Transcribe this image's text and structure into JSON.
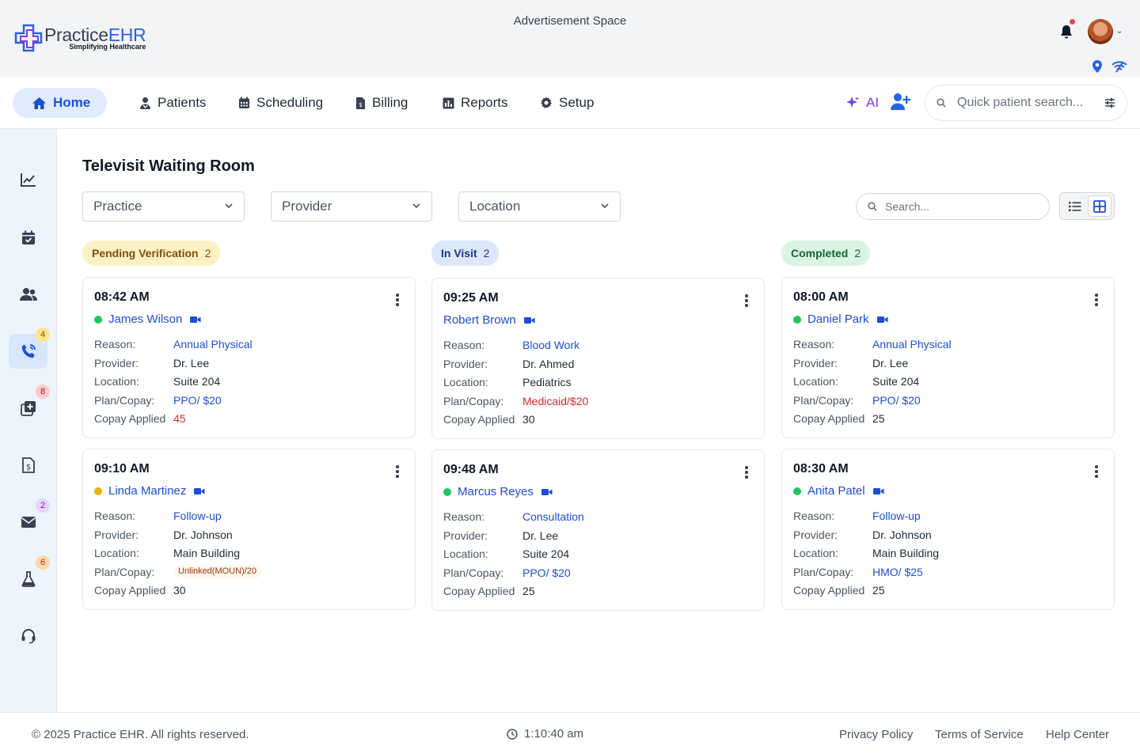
{
  "header": {
    "logo_practice": "Practice",
    "logo_ehr": "EHR",
    "logo_tagline": "Simplifying Healthcare",
    "ad_space": "Advertisement Space"
  },
  "nav": {
    "items": [
      {
        "label": "Home",
        "icon": "home-icon"
      },
      {
        "label": "Patients",
        "icon": "patient-icon"
      },
      {
        "label": "Scheduling",
        "icon": "calendar-icon"
      },
      {
        "label": "Billing",
        "icon": "invoice-icon"
      },
      {
        "label": "Reports",
        "icon": "chart-icon"
      },
      {
        "label": "Setup",
        "icon": "gear-icon"
      }
    ],
    "ai_label": "AI",
    "quick_search_placeholder": "Quick patient search..."
  },
  "sidebar": {
    "items": [
      {
        "icon": "analytics-icon",
        "badge": ""
      },
      {
        "icon": "calendar-check-icon",
        "badge": ""
      },
      {
        "icon": "users-icon",
        "badge": ""
      },
      {
        "icon": "phone-icon",
        "badge": "4"
      },
      {
        "icon": "medical-plus-icon",
        "badge": "8"
      },
      {
        "icon": "billing-doc-icon",
        "badge": ""
      },
      {
        "icon": "mail-icon",
        "badge": "2"
      },
      {
        "icon": "flask-icon",
        "badge": "6"
      },
      {
        "icon": "headset-icon",
        "badge": ""
      }
    ]
  },
  "main": {
    "title": "Televisit Waiting Room",
    "filters": {
      "practice": "Practice",
      "provider": "Provider",
      "location": "Location"
    },
    "search_placeholder": "Search...",
    "labels": {
      "reason": "Reason:",
      "provider": "Provider:",
      "location": "Location:",
      "plan": "Plan/Copay:",
      "copay": "Copay Applied"
    },
    "columns": [
      {
        "title": "Pending Verification",
        "count": "2",
        "cards": [
          {
            "time": "08:42 AM",
            "name": "James Wilson",
            "status": "green",
            "reason": "Annual Physical",
            "provider": "Dr. Lee",
            "location": "Suite 204",
            "plan": "PPO/ $20",
            "plan_style": "link",
            "copay": "45",
            "copay_style": "red"
          },
          {
            "time": "09:10 AM",
            "name": "Linda Martinez",
            "status": "yellow",
            "reason": "Follow-up",
            "provider": "Dr. Johnson",
            "location": "Main Building",
            "plan": "Unlinked(MOUN)/20",
            "plan_style": "chip",
            "copay": "30",
            "copay_style": ""
          }
        ]
      },
      {
        "title": "In Visit",
        "count": "2",
        "cards": [
          {
            "time": "09:25 AM",
            "name": "Robert Brown",
            "status": "",
            "reason": "Blood Work",
            "provider": "Dr. Ahmed",
            "location": "Pediatrics",
            "plan": "Medicaid/$20",
            "plan_style": "red",
            "copay": "30",
            "copay_style": ""
          },
          {
            "time": "09:48 AM",
            "name": "Marcus Reyes",
            "status": "green",
            "reason": "Consultation",
            "provider": "Dr. Lee",
            "location": "Suite 204",
            "plan": "PPO/ $20",
            "plan_style": "link",
            "copay": "25",
            "copay_style": ""
          }
        ]
      },
      {
        "title": "Completed",
        "count": "2",
        "cards": [
          {
            "time": "08:00 AM",
            "name": "Daniel Park",
            "status": "green",
            "reason": "Annual Physical",
            "provider": "Dr. Lee",
            "location": "Suite 204",
            "plan": "PPO/ $20",
            "plan_style": "link",
            "copay": "25",
            "copay_style": ""
          },
          {
            "time": "08:30 AM",
            "name": "Anita Patel",
            "status": "green",
            "reason": "Follow-up",
            "provider": "Dr. Johnson",
            "location": "Main Building",
            "plan": "HMO/ $25",
            "plan_style": "link",
            "copay": "25",
            "copay_style": ""
          }
        ]
      }
    ]
  },
  "footer": {
    "copyright": "© 2025 Practice EHR. All rights reserved.",
    "time": "1:10:40 am",
    "privacy": "Privacy Policy",
    "terms": "Terms of Service",
    "help": "Help Center"
  },
  "colors": {
    "accent": "#2563eb",
    "pending_bg": "#fdf0c4",
    "pending_text": "#854d0e",
    "invisit_bg": "#dbe7fb",
    "invisit_text": "#1e3a8a",
    "completed_bg": "#d9f5e1",
    "completed_text": "#166534",
    "status_green": "#22c55e",
    "status_yellow": "#eab308"
  }
}
